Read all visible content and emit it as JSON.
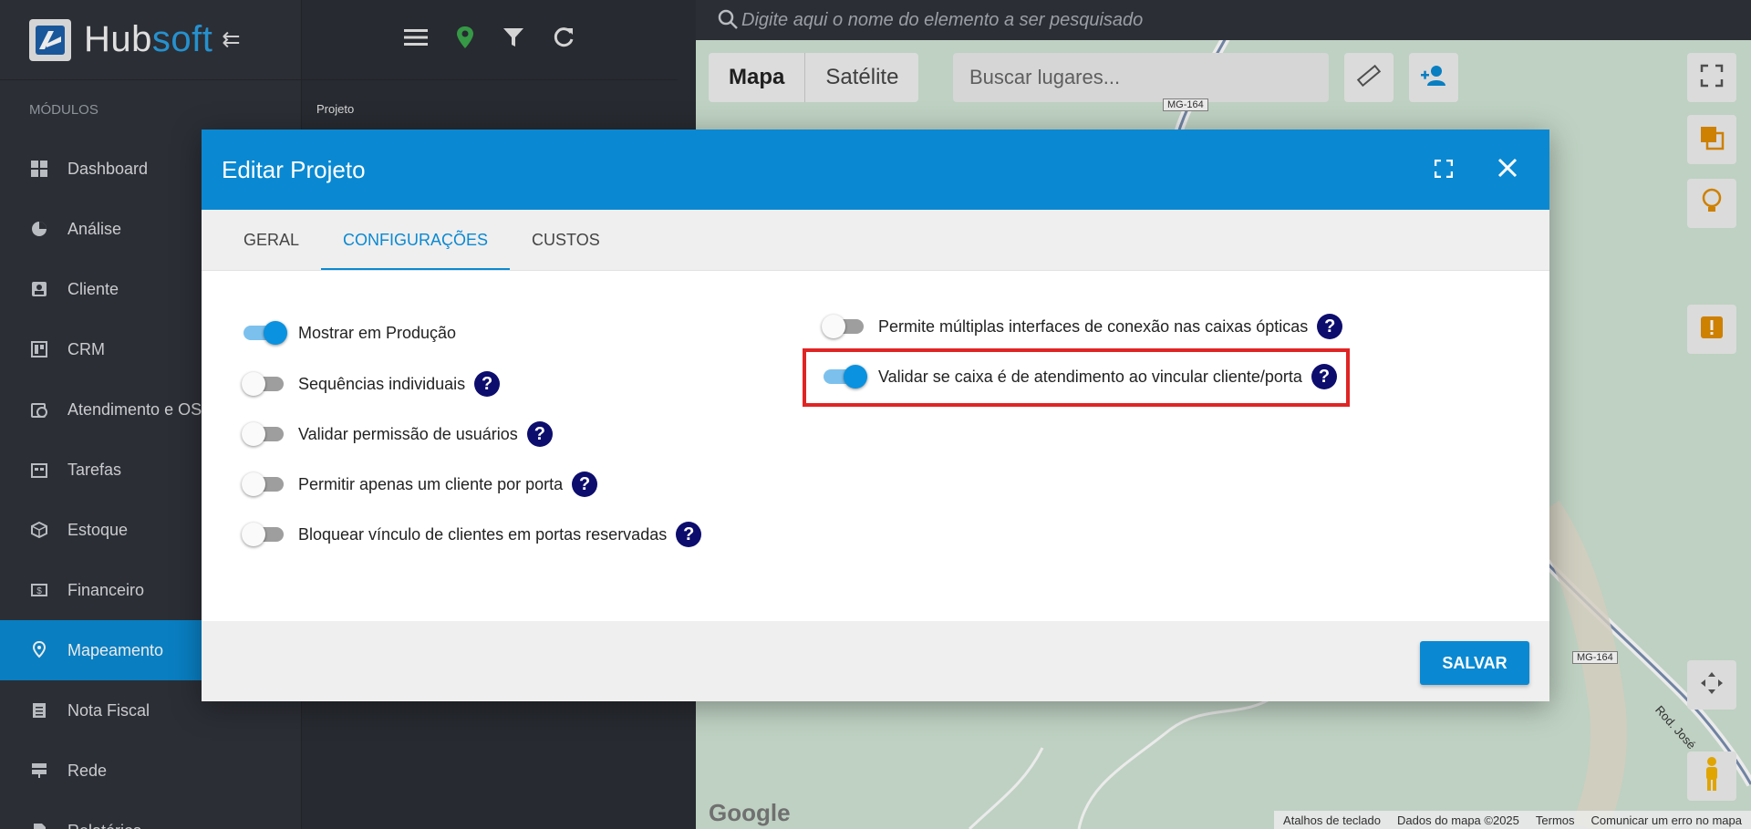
{
  "sidebar": {
    "logo_hub": "Hub",
    "logo_soft": "soft",
    "modules_label": "MÓDULOS",
    "items": [
      {
        "label": "Dashboard",
        "icon": "dashboard-icon"
      },
      {
        "label": "Análise",
        "icon": "pie-chart-icon"
      },
      {
        "label": "Cliente",
        "icon": "contact-card-icon"
      },
      {
        "label": "CRM",
        "icon": "crm-board-icon"
      },
      {
        "label": "Atendimento e OS",
        "icon": "calendar-clock-icon"
      },
      {
        "label": "Tarefas",
        "icon": "tasks-icon"
      },
      {
        "label": "Estoque",
        "icon": "box-icon"
      },
      {
        "label": "Financeiro",
        "icon": "money-icon"
      },
      {
        "label": "Mapeamento",
        "icon": "map-pin-icon",
        "active": true
      },
      {
        "label": "Nota Fiscal",
        "icon": "invoice-icon"
      },
      {
        "label": "Rede",
        "icon": "server-icon"
      },
      {
        "label": "Relatórios",
        "icon": "report-icon"
      }
    ]
  },
  "panel2": {
    "label": "Projeto"
  },
  "map": {
    "search_placeholder": "Digite aqui o nome do elemento a ser pesquisado",
    "type_map": "Mapa",
    "type_satellite": "Satélite",
    "places_placeholder": "Buscar lugares...",
    "road_label_1": "MG-164",
    "road_label_2": "MG-164",
    "road_label_3": "Rod. José",
    "google_logo": "Google",
    "footer": [
      "Atalhos de teclado",
      "Dados do mapa ©2025",
      "Termos",
      "Comunicar um erro no mapa"
    ]
  },
  "modal": {
    "title": "Editar Projeto",
    "tabs": [
      "GERAL",
      "CONFIGURAÇÕES",
      "CUSTOS"
    ],
    "active_tab": 1,
    "left_options": [
      {
        "label": "Mostrar em Produção",
        "on": true,
        "help": false
      },
      {
        "label": "Sequências individuais",
        "on": false,
        "help": true
      },
      {
        "label": "Validar permissão de usuários",
        "on": false,
        "help": true
      },
      {
        "label": "Permitir apenas um cliente por porta",
        "on": false,
        "help": true
      },
      {
        "label": "Bloquear vínculo de clientes em portas reservadas",
        "on": false,
        "help": true
      }
    ],
    "right_options": [
      {
        "label": "Permite múltiplas interfaces de conexão nas caixas ópticas",
        "on": false,
        "help": true
      },
      {
        "label": "Validar se caixa é de atendimento ao vincular cliente/porta",
        "on": true,
        "help": true,
        "highlighted": true
      }
    ],
    "help_glyph": "?",
    "save_label": "SALVAR"
  },
  "colors": {
    "accent": "#0a89d2",
    "highlight_border": "#e02424",
    "help_badge": "#0d0d6e"
  }
}
